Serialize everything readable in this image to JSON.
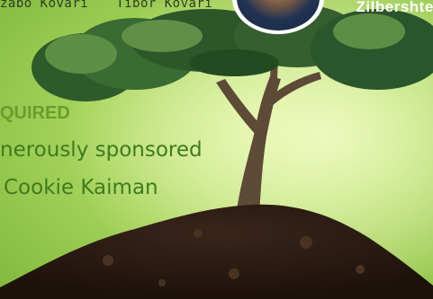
{
  "top_names": {
    "left_1": "zabo Kovari",
    "left_2": "Tibor Kovari",
    "right": "Zilbershtei"
  },
  "heading": "QUIRED",
  "sponsor_line_1": "nerously sponsored",
  "sponsor_line_2": "Cookie Kaiman",
  "colors": {
    "background_light": "#d6ef96",
    "background_dark": "#7fb83a",
    "heading": "#6a9d2e",
    "body_text": "#3f7b1f",
    "soil": "#2b1a12"
  }
}
